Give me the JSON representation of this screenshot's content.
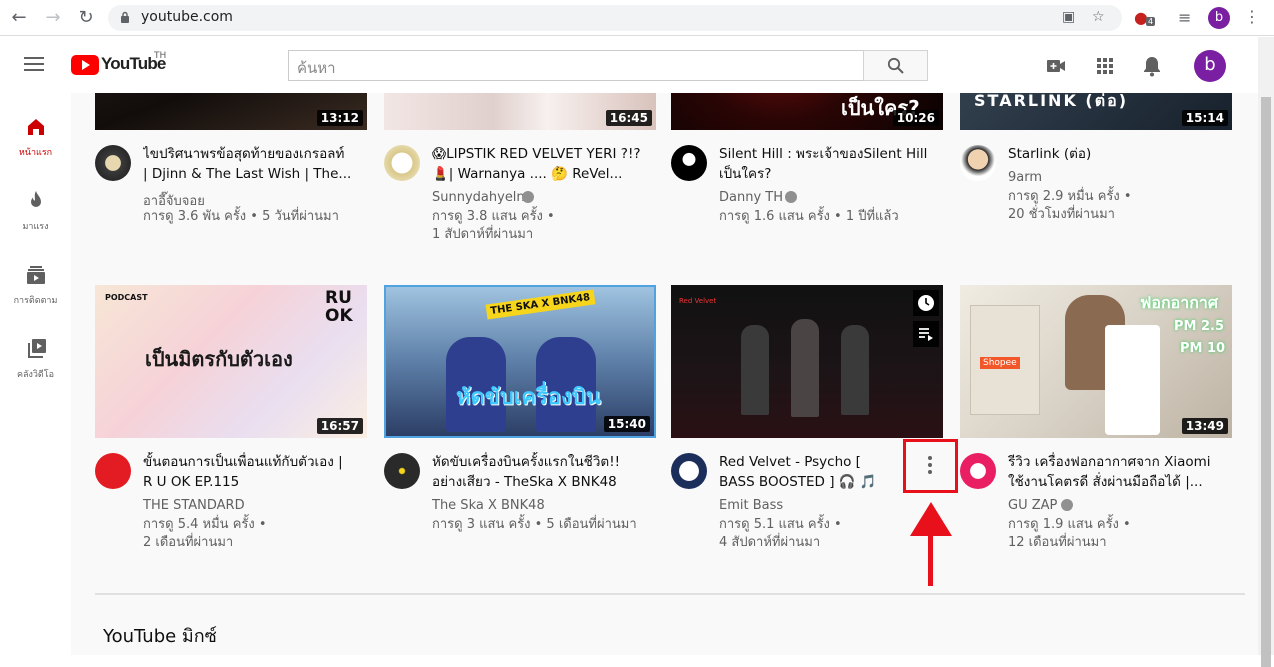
{
  "browser": {
    "url": "youtube.com",
    "profile_letter": "b",
    "ext_badge": "4"
  },
  "header": {
    "logo_text": "YouTube",
    "country_code": "TH",
    "search_placeholder": "ค้นหา",
    "avatar_letter": "b"
  },
  "sidebar": {
    "items": [
      {
        "label": "หน้าแรก",
        "icon": "home-icon",
        "active": true
      },
      {
        "label": "มาแรง",
        "icon": "flame-icon",
        "active": false
      },
      {
        "label": "การติดตาม",
        "icon": "subscriptions-icon",
        "active": false
      },
      {
        "label": "คลังวิดีโอ",
        "icon": "library-icon",
        "active": false
      }
    ]
  },
  "row1": [
    {
      "duration": "13:12",
      "title": "ไขปริศนาพรข้อสุดท้ายของเกรอลท์ | Djinn & The Last Wish | The...",
      "channel": "อาอี๊จับจอย",
      "verified": false,
      "meta1": "การดู 3.6 พัน ครั้ง • 5 วันที่ผ่านมา",
      "meta2": ""
    },
    {
      "duration": "16:45",
      "title": "😱LIPSTIK RED VELVET YERI ?!?💄| Warnanya .... 🤔 ReVel...",
      "channel": "Sunnydahyeln",
      "verified": true,
      "meta1": "การดู 3.8 แสน ครั้ง •",
      "meta2": "1 สัปดาห์ที่ผ่านมา"
    },
    {
      "duration": "10:26",
      "title": "Silent Hill : พระเจ้าของSilent Hill เป็นใคร?",
      "channel": "Danny TH",
      "verified": true,
      "meta1": "การดู 1.6 แสน ครั้ง • 1 ปีที่แล้ว",
      "meta2": ""
    },
    {
      "duration": "15:14",
      "title": "Starlink (ต่อ)",
      "channel": "9arm",
      "verified": false,
      "meta1": "การดู 2.9 หมื่น ครั้ง •",
      "meta2": "20 ชั่วโมงที่ผ่านมา"
    }
  ],
  "row2": [
    {
      "duration": "16:57",
      "title": "ขั้นตอนการเป็นเพื่อนแท้กับตัวเอง | R U OK EP.115",
      "channel": "THE STANDARD",
      "verified": false,
      "meta1": "การดู 5.4 หมื่น ครั้ง •",
      "meta2": "2 เดือนที่ผ่านมา",
      "thumb_text": "เป็นมิตรกับตัวเอง",
      "thumb_sub": "PODCAST",
      "thumb_brand": "RU OK"
    },
    {
      "duration": "15:40",
      "title": "หัดขับเครื่องบินครั้งแรกในชีวิต!! อย่างเสียว - TheSka X BNK48",
      "channel": "The Ska X BNK48",
      "verified": false,
      "meta1": "การดู 3 แสน ครั้ง • 5 เดือนที่ผ่านมา",
      "meta2": "",
      "thumb_text": "หัดขับเครื่องบิน",
      "thumb_sub": "THE SKA X BNK48"
    },
    {
      "duration": "",
      "title": "Red Velvet - Psycho [ BASS BOOSTED ] 🎧 🎵",
      "channel": "Emit Bass",
      "verified": false,
      "meta1": "การดู 5.1 แสน ครั้ง •",
      "meta2": "4 สัปดาห์ที่ผ่านมา",
      "thumb_sub": "Red Velvet"
    },
    {
      "duration": "13:49",
      "title": "รีวิว เครื่องฟอกอากาศจาก Xiaomi ใช้งานโคตรดี สั่งผ่านมือถือได้ |...",
      "channel": "GU ZAP",
      "verified": true,
      "meta1": "การดู 1.9 แสน ครั้ง •",
      "meta2": "12 เดือนที่ผ่านมา",
      "thumb_text": "ฟอกอากาศ",
      "thumb_sub": "PM 2.5",
      "thumb_sub2": "PM 10",
      "thumb_brand": "Shopee"
    }
  ],
  "thumb_top_texts": {
    "silent": "เป็นใคร?",
    "starlink": "STARLINK (ต่อ)"
  },
  "section": {
    "title": "YouTube มิกซ์"
  },
  "colors": {
    "brand_red": "#ff0000",
    "annotation_red": "#e8101a",
    "avatar_purple": "#7b1fa2"
  }
}
